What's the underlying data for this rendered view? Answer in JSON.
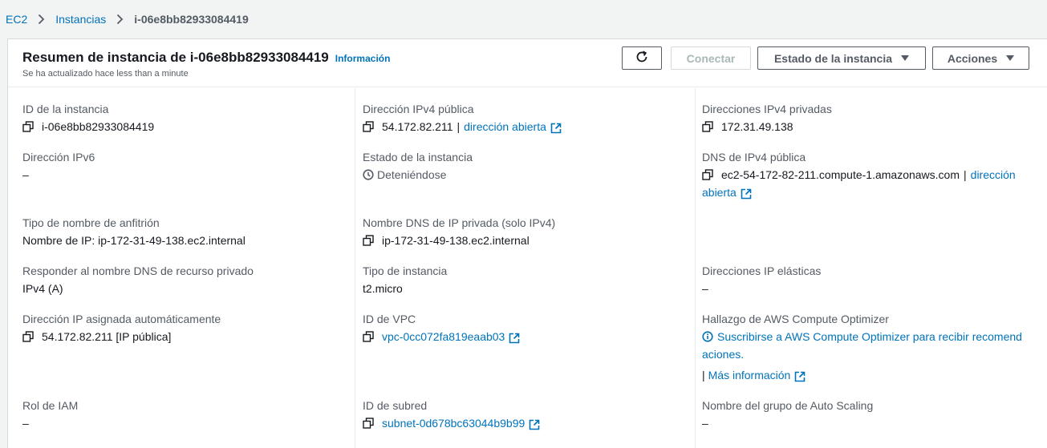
{
  "breadcrumb": {
    "root": "EC2",
    "section": "Instancias",
    "current": "i-06e8bb82933084419"
  },
  "header": {
    "title": "Resumen de instancia de i-06e8bb82933084419",
    "info": "Información",
    "subtitle": "Se ha actualizado hace less than a minute",
    "connect": "Conectar",
    "state": "Estado de la instancia",
    "actions": "Acciones"
  },
  "col1": {
    "instance_id_label": "ID de la instancia",
    "instance_id": "i-06e8bb82933084419",
    "ipv6_label": "Dirección IPv6",
    "ipv6": "–",
    "hostname_type_label": "Tipo de nombre de anfitrión",
    "hostname_type": "Nombre de IP: ip-172-31-49-138.ec2.internal",
    "dns_reply_label": "Responder al nombre DNS de recurso privado",
    "dns_reply": "IPv4 (A)",
    "auto_ip_label": "Dirección IP asignada automáticamente",
    "auto_ip": "54.172.82.211 [IP pública]",
    "iam_label": "Rol de IAM",
    "iam": "–"
  },
  "col2": {
    "public_ipv4_label": "Dirección IPv4 pública",
    "public_ipv4": "54.172.82.211",
    "open_address": "dirección abierta",
    "state_label": "Estado de la instancia",
    "state": "Deteniéndose",
    "private_dns_label": "Nombre DNS de IP privada (solo IPv4)",
    "private_dns": "ip-172-31-49-138.ec2.internal",
    "instance_type_label": "Tipo de instancia",
    "instance_type": "t2.micro",
    "vpc_label": "ID de VPC",
    "vpc": "vpc-0cc072fa819eaab03",
    "subnet_label": "ID de subred",
    "subnet": "subnet-0d678bc63044b9b99"
  },
  "col3": {
    "private_ipv4_label": "Direcciones IPv4 privadas",
    "private_ipv4": "172.31.49.138",
    "public_dns_label": "DNS de IPv4 pública",
    "public_dns": "ec2-54-172-82-211.compute-1.amazonaws.com",
    "open_address_1": "dirección",
    "open_address_2": "abierta",
    "elastic_ip_label": "Direcciones IP elásticas",
    "elastic_ip": "–",
    "optimizer_label": "Hallazgo de AWS Compute Optimizer",
    "optimizer_text_1": "Suscribirse a AWS Compute Optimizer para recibir recomend",
    "optimizer_text_2": "aciones.",
    "more_info": "Más información",
    "asg_label": "Nombre del grupo de Auto Scaling",
    "asg": "–"
  },
  "colors": {
    "link": "#0073bb",
    "text": "#16191f",
    "muted": "#545b64",
    "border": "#d5dbdb"
  }
}
